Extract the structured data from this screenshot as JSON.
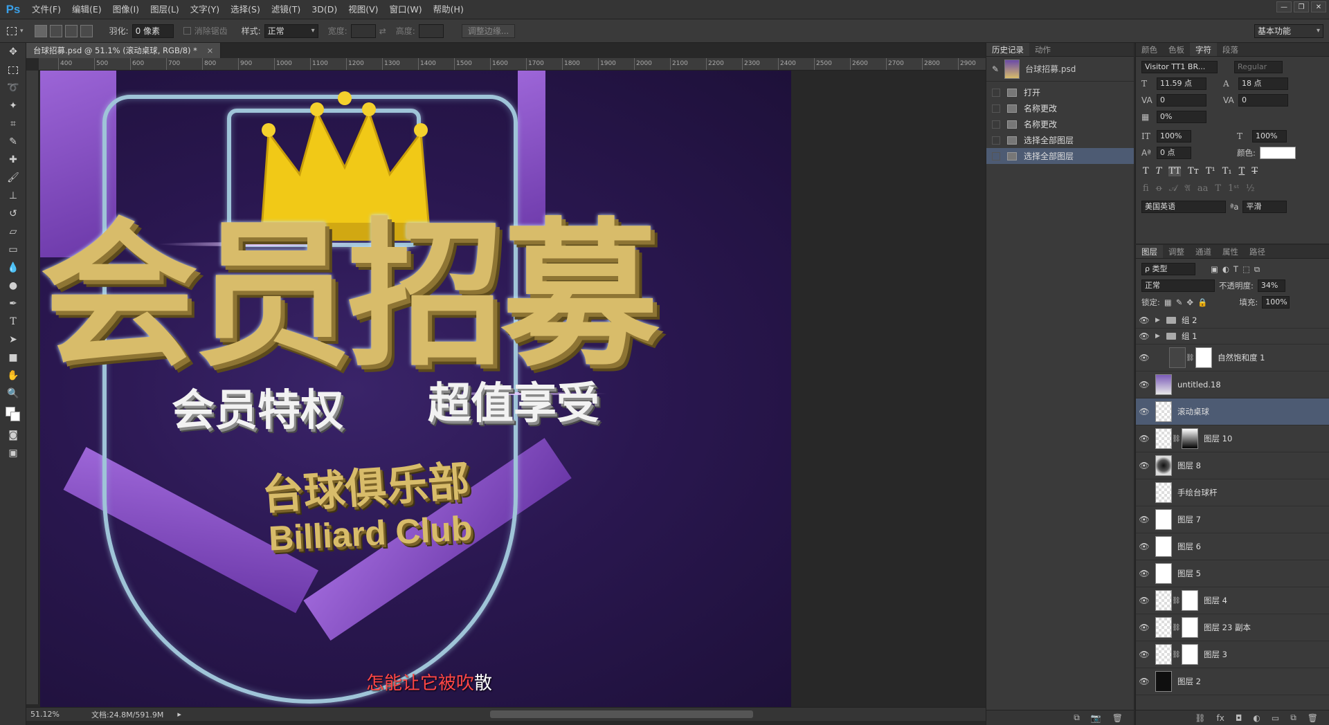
{
  "app": {
    "logo": "Ps",
    "menu": [
      "文件(F)",
      "编辑(E)",
      "图像(I)",
      "图层(L)",
      "文字(Y)",
      "选择(S)",
      "滤镜(T)",
      "3D(D)",
      "视图(V)",
      "窗口(W)",
      "帮助(H)"
    ],
    "window_controls": [
      "—",
      "❐",
      "✕"
    ]
  },
  "options": {
    "feather_label": "羽化:",
    "feather_value": "0 像素",
    "antialias_label": "消除锯齿",
    "style_label": "样式:",
    "style_value": "正常",
    "width_label": "宽度:",
    "height_label": "高度:",
    "refine_button": "调整边缘...",
    "workspace": "基本功能"
  },
  "document": {
    "tab_title": "台球招募.psd @ 51.1% (滚动桌球, RGB/8) *",
    "tab_close": "×",
    "ruler_ticks": [
      "400",
      "500",
      "600",
      "700",
      "800",
      "900",
      "1000",
      "1100",
      "1200",
      "1300",
      "1400",
      "1500",
      "1600",
      "1700",
      "1800",
      "1900",
      "2000",
      "2100",
      "2200",
      "2300",
      "2400",
      "2500",
      "2600",
      "2700",
      "2800",
      "2900"
    ],
    "zoom": "51.12%",
    "doc_info": "文档:24.8M/591.9M",
    "subtitle_red": "怎能让它被吹",
    "subtitle_white": "散"
  },
  "artwork": {
    "title": "会员招募",
    "line_left": "会员特权",
    "line_right": "超值享受",
    "club_cn": "台球俱乐部",
    "club_en": "Billiard Club"
  },
  "history": {
    "tabs": [
      "历史记录",
      "动作"
    ],
    "snapshot": "台球招募.psd",
    "items": [
      "打开",
      "名称更改",
      "名称更改",
      "选择全部图层",
      "选择全部图层"
    ]
  },
  "character": {
    "tabs": [
      "颜色",
      "色板",
      "字符",
      "段落"
    ],
    "font_family": "Visitor TT1 BR...",
    "font_style": "Regular",
    "font_size": "11.59 点",
    "leading": "18 点",
    "kerning": "0",
    "tracking": "0",
    "scale_pct": "0%",
    "vscale": "100%",
    "hscale": "100%",
    "baseline": "0 点",
    "color_label": "颜色:",
    "language": "美国英语",
    "aa_label": "ªa",
    "antialias": "平滑"
  },
  "layers": {
    "tabs": [
      "图层",
      "调整",
      "通道",
      "属性",
      "路径"
    ],
    "filter_kind": "ρ 类型",
    "blend_mode": "正常",
    "opacity_label": "不透明度:",
    "opacity": "34%",
    "lock_label": "锁定:",
    "fill_label": "填充:",
    "fill": "100%",
    "items": [
      {
        "name": "组 2",
        "kind": "group"
      },
      {
        "name": "组 1",
        "kind": "group"
      },
      {
        "name": "自然饱和度 1",
        "kind": "adjust"
      },
      {
        "name": "untitled.18",
        "kind": "art"
      },
      {
        "name": "滚动桌球",
        "kind": "smart"
      },
      {
        "name": "图层 10",
        "kind": "mask"
      },
      {
        "name": "图层 8",
        "kind": "glow"
      },
      {
        "name": "手绘台球杆",
        "kind": "smart"
      },
      {
        "name": "图层 7",
        "kind": "white"
      },
      {
        "name": "图层 6",
        "kind": "white"
      },
      {
        "name": "图层 5",
        "kind": "white"
      },
      {
        "name": "图层 4",
        "kind": "mask"
      },
      {
        "name": "图层 23 副本",
        "kind": "mask"
      },
      {
        "name": "图层 3",
        "kind": "mask"
      },
      {
        "name": "图层 2",
        "kind": "dark"
      }
    ]
  },
  "colors": {
    "accent": "#3aa0e8",
    "selection": "#4d5b73",
    "canvas_purple": "#2a1750",
    "gold": "#d8bc6a",
    "subtitle_red": "#ff4646"
  }
}
